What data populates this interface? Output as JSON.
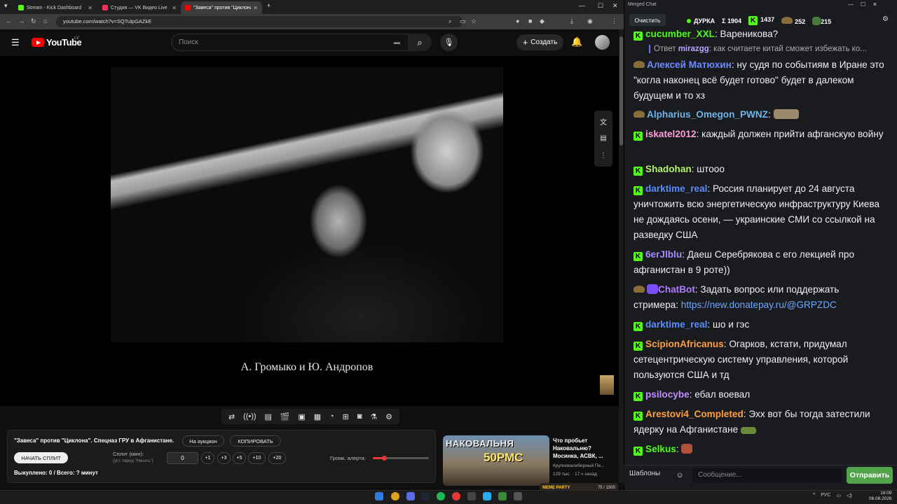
{
  "browser": {
    "tabs": [
      {
        "label": "Stream - Kick Dashboard",
        "color": "#53fc18"
      },
      {
        "label": "Студия — VK Видео Live",
        "color": "#ff2d55"
      },
      {
        "label": "\"Завеса\" против \"Циклона\"",
        "color": "#ff0000"
      }
    ],
    "url": "youtube.com/watch?v=SQTulpGAZkE"
  },
  "youtube": {
    "logo_text": "YouTube",
    "country": "LV",
    "search_placeholder": "Поиск",
    "create_label": "Создать"
  },
  "video": {
    "caption": "А. Громыко и Ю. Андропов"
  },
  "split_panel": {
    "title": "\"Завеса\" против \"Циклона\". Спецназ ГРУ в Афганистане.",
    "auction_label": "На аукцион",
    "copy_label": "КОПИРОВАТЬ",
    "start_label": "НАЧАТЬ СПЛИТ",
    "split_label": "Сплит (мин):",
    "split_hint": "(уст. перед \"Начать\")",
    "split_value": "0",
    "increments": [
      "+1",
      "+3",
      "+5",
      "+10",
      "+20"
    ],
    "bought": "Выкуплено: 0 / Всего: ? минут",
    "volume_label": "Громк. алерта:",
    "volume_level": 0.2
  },
  "recommended": {
    "thumb_text": "НАКОВАЛЬНЯ",
    "thumb_num": "50РМС",
    "title": "Что пробьет Наковальню? Мосинка, АСВК, ...",
    "channel": "Крупнокалиберный Пе...",
    "views": "129 тыс.",
    "age": "17 ч назад",
    "meme_label": "MEME PARTY",
    "meme_count": "75 / 1500"
  },
  "chat": {
    "window_title": "Merged Chat",
    "clear_label": "Очистить",
    "channel_name": "ДУРКА",
    "stats": [
      "Σ 1904",
      "1437",
      "252",
      "215"
    ],
    "reply": {
      "prefix": "Ответ",
      "user": "mirazgg",
      "text": ": как считаете китай сможет избежать ко..."
    },
    "messages": [
      {
        "user": "cucumber_XXL",
        "color": "#53fc18",
        "text": ": Вареникова?"
      },
      {
        "user": "Алексей Матюхин",
        "color": "#6b8cff",
        "text": ": ну судя по событиям в Иране это \"когла наконец всё будет готово\" будет в далеком будущем и то хз"
      },
      {
        "user": "Alpharius_Omegon_PWNZ",
        "color": "#6fb3e8",
        "text": ":"
      },
      {
        "user": "iskatel2012",
        "color": "#ff9ed8",
        "text": ": каждый должен прийти афганскую войну"
      },
      {
        "user": "Shadohan",
        "color": "#b4f06a",
        "text": ": штооо"
      },
      {
        "user": "darktime_real",
        "color": "#5b8cff",
        "text": ": Россия планирует до 24 августа уничтожить всю энергетическую инфраструктуру Киева не дождаясь осени, — украинские СМИ со ссылкой на разведку США"
      },
      {
        "user": "6erJlblu",
        "color": "#a68cff",
        "text": ": Даеш Серебрякова с его лекцией про афганистан в 9 роте))"
      },
      {
        "user": "ChatBot",
        "color": "#b07cff",
        "text": ": Задать вопрос или поддержать стримера: ",
        "link": "https://new.donatepay.ru/@GRPZDC"
      },
      {
        "user": "darktime_real",
        "color": "#5b8cff",
        "text": ": шо и гэс"
      },
      {
        "user": "ScipionAfricanus",
        "color": "#ff9f43",
        "text": ": Огарков, кстати, придумал сетецентрическую систему управления, которой пользуются США и тд"
      },
      {
        "user": "psilocybe",
        "color": "#c58cff",
        "text": ": ебал воевал"
      },
      {
        "user": "Arestovi4_Completed",
        "color": "#ff9f43",
        "text": ": Эхх вот бы тогда затестили ядерку на Афганистане"
      },
      {
        "user": "Selkus",
        "color": "#53fc18",
        "text": ":"
      }
    ],
    "templates_label": "Шаблоны",
    "input_placeholder": "Сообщение...",
    "send_label": "Отправить"
  },
  "taskbar": {
    "lang": "РУС",
    "time": "16:09",
    "date": "08.08.2026"
  }
}
